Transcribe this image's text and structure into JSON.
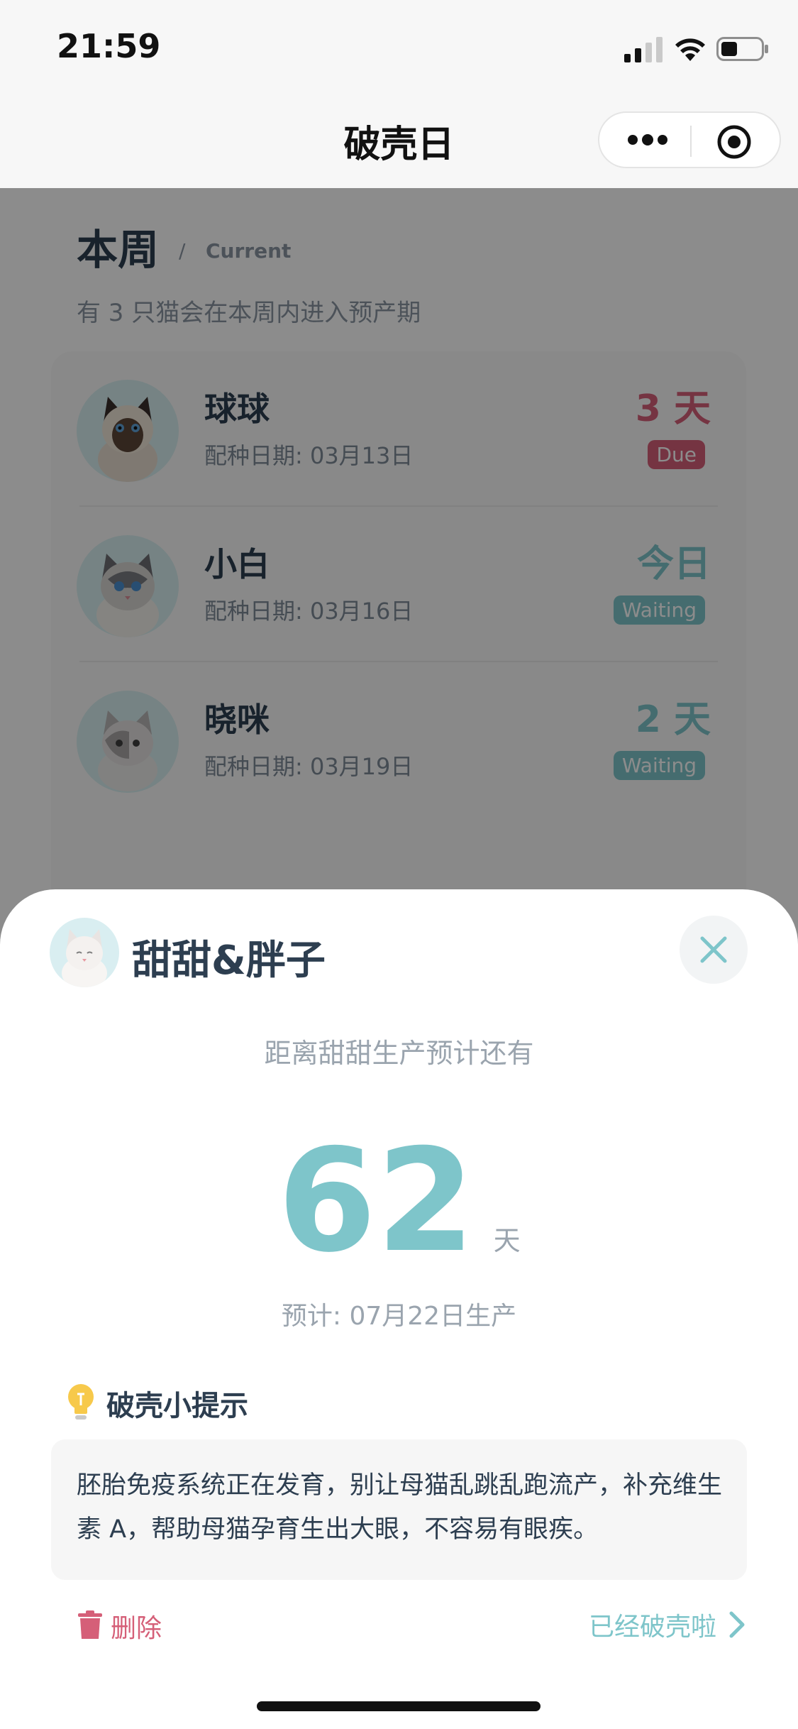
{
  "status_bar": {
    "time": "21:59"
  },
  "nav": {
    "title": "破壳日"
  },
  "week": {
    "title": "本周",
    "slash": "/",
    "subtitle": "Current",
    "description": "有 3 只猫会在本周内进入预产期"
  },
  "cats": [
    {
      "name": "球球",
      "mating_date": "配种日期: 03月13日",
      "days": "3 天",
      "status": "Due",
      "status_color": "#d55f78"
    },
    {
      "name": "小白",
      "mating_date": "配种日期: 03月16日",
      "days": "今日",
      "status": "Waiting",
      "status_color": "#7ec5ca"
    },
    {
      "name": "晓咪",
      "mating_date": "配种日期: 03月19日",
      "days": "2 天",
      "status": "Waiting",
      "status_color": "#7ec5ca"
    }
  ],
  "sheet": {
    "name": "甜甜&胖子",
    "countdown_label": "距离甜甜生产预计还有",
    "days": "62",
    "unit": "天",
    "expected": "预计: 07月22日生产",
    "tip_title": "破壳小提示",
    "tip_text": "胚胎免疫系统正在发育，别让母猫乱跳乱跑流产，补充维生素 A，帮助母猫孕育生出大眼，不容易有眼疾。",
    "delete_label": "删除",
    "hatched_label": "已经破壳啦"
  },
  "colors": {
    "accent": "#7ec5ca",
    "danger": "#d55f78",
    "text": "#2d3e50"
  }
}
